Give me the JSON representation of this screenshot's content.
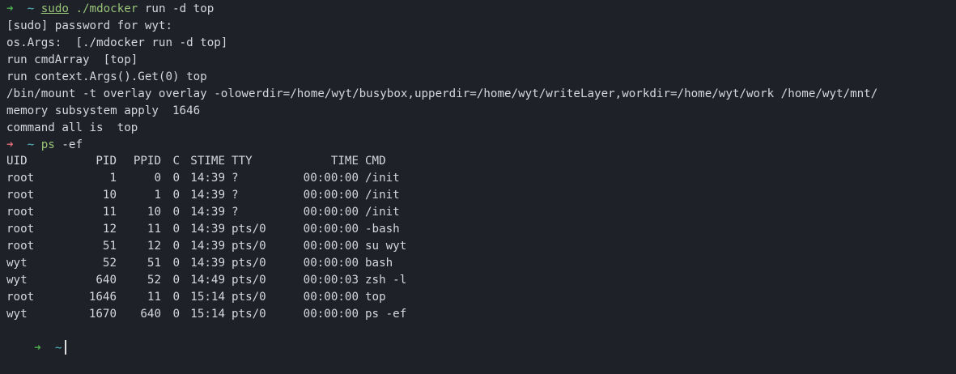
{
  "prompt": {
    "arrow": "➜",
    "dir": "~"
  },
  "history": [
    {
      "kind": "prompt",
      "status": "ok",
      "parts": [
        {
          "text": "sudo",
          "style": "cmd-ul"
        },
        {
          "text": " ",
          "style": "args"
        },
        {
          "text": "./mdocker",
          "style": "cmd-name"
        },
        {
          "text": " run -d top",
          "style": "args"
        }
      ]
    },
    {
      "kind": "output",
      "text": "[sudo] password for wyt:"
    },
    {
      "kind": "output",
      "text": "os.Args:  [./mdocker run -d top]"
    },
    {
      "kind": "output",
      "text": "run cmdArray  [top]"
    },
    {
      "kind": "output",
      "text": "run context.Args().Get(0) top"
    },
    {
      "kind": "output",
      "text": "/bin/mount -t overlay overlay -olowerdir=/home/wyt/busybox,upperdir=/home/wyt/writeLayer,workdir=/home/wyt/work /home/wyt/mnt/"
    },
    {
      "kind": "output",
      "text": "memory subsystem apply  1646"
    },
    {
      "kind": "output",
      "text": "command all is  top"
    },
    {
      "kind": "prompt",
      "status": "err",
      "parts": [
        {
          "text": "ps",
          "style": "cmd-name"
        },
        {
          "text": " -ef",
          "style": "args"
        }
      ]
    }
  ],
  "ps_table": {
    "headers": [
      "UID",
      "PID",
      "PPID",
      "C",
      "STIME",
      "TTY",
      "TIME",
      "CMD"
    ],
    "rows": [
      [
        "root",
        "1",
        "0",
        "0",
        "14:39",
        "?",
        "00:00:00",
        "/init"
      ],
      [
        "root",
        "10",
        "1",
        "0",
        "14:39",
        "?",
        "00:00:00",
        "/init"
      ],
      [
        "root",
        "11",
        "10",
        "0",
        "14:39",
        "?",
        "00:00:00",
        "/init"
      ],
      [
        "root",
        "12",
        "11",
        "0",
        "14:39",
        "pts/0",
        "00:00:00",
        "-bash"
      ],
      [
        "root",
        "51",
        "12",
        "0",
        "14:39",
        "pts/0",
        "00:00:00",
        "su wyt"
      ],
      [
        "wyt",
        "52",
        "51",
        "0",
        "14:39",
        "pts/0",
        "00:00:00",
        "bash"
      ],
      [
        "wyt",
        "640",
        "52",
        "0",
        "14:49",
        "pts/0",
        "00:00:03",
        "zsh -l"
      ],
      [
        "root",
        "1646",
        "11",
        "0",
        "15:14",
        "pts/0",
        "00:00:00",
        "top"
      ],
      [
        "wyt",
        "1670",
        "640",
        "0",
        "15:14",
        "pts/0",
        "00:00:00",
        "ps -ef"
      ]
    ]
  },
  "colors": {
    "background": "#1e2127",
    "foreground": "#d4d7dc",
    "prompt_ok": "#4caf50",
    "prompt_err": "#e06c75",
    "dir": "#56b6c2",
    "command": "#98c379"
  }
}
